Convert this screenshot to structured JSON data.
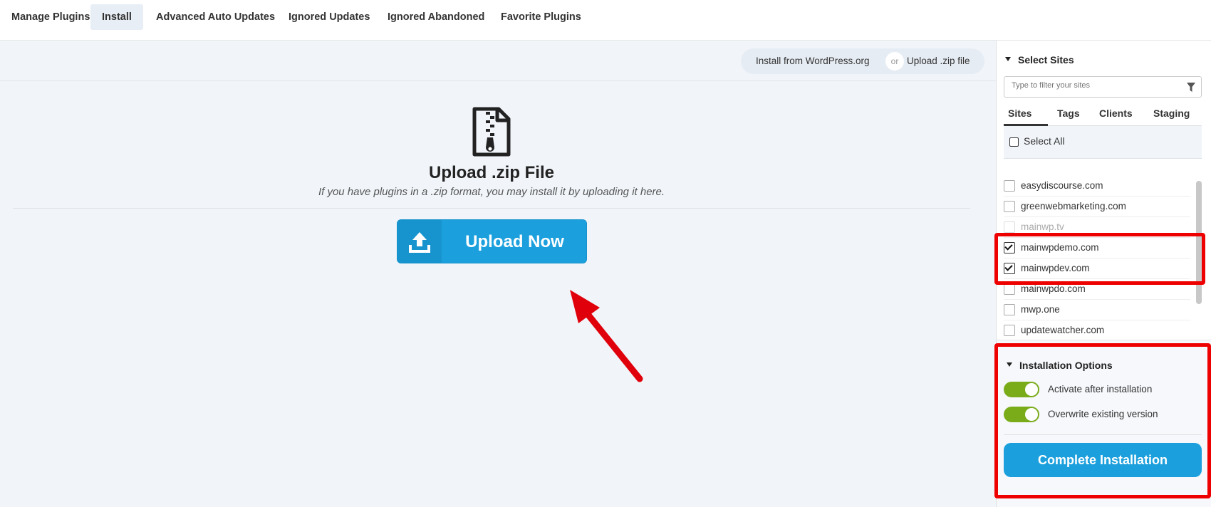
{
  "nav": {
    "tabs": [
      {
        "label": "Manage Plugins"
      },
      {
        "label": "Install"
      },
      {
        "label": "Advanced Auto Updates"
      },
      {
        "label": "Ignored Updates"
      },
      {
        "label": "Ignored Abandoned"
      },
      {
        "label": "Favorite Plugins"
      }
    ],
    "active_tab": "Install"
  },
  "source_toggle": {
    "option1": "Install from WordPress.org",
    "or": "or",
    "option2": "Upload .zip file"
  },
  "upload": {
    "title": "Upload .zip File",
    "subtitle": "If you have plugins in a .zip format, you may install it by uploading it here.",
    "button_label": "Upload Now"
  },
  "sidebar": {
    "select_sites_title": "Select Sites",
    "filter_placeholder": "Type to filter your sites",
    "tabs": [
      {
        "label": "Sites"
      },
      {
        "label": "Tags"
      },
      {
        "label": "Clients"
      },
      {
        "label": "Staging"
      }
    ],
    "select_all_label": "Select All",
    "sites": [
      {
        "name": "easydiscourse.com",
        "checked": false,
        "disabled": false
      },
      {
        "name": "greenwebmarketing.com",
        "checked": false,
        "disabled": false
      },
      {
        "name": "mainwp.tv",
        "checked": false,
        "disabled": true
      },
      {
        "name": "mainwpdemo.com",
        "checked": true,
        "disabled": false
      },
      {
        "name": "mainwpdev.com",
        "checked": true,
        "disabled": false
      },
      {
        "name": "mainwpdo.com",
        "checked": false,
        "disabled": false
      },
      {
        "name": "mwp.one",
        "checked": false,
        "disabled": false
      },
      {
        "name": "updatewatcher.com",
        "checked": false,
        "disabled": false
      }
    ],
    "installation_options_title": "Installation Options",
    "options": [
      {
        "label": "Activate after installation",
        "on": true
      },
      {
        "label": "Overwrite existing version",
        "on": true
      }
    ],
    "complete_button": "Complete Installation"
  },
  "colors": {
    "accent_blue": "#1ba0dd",
    "toggle_green": "#7aac1a",
    "highlight_red": "#ee0000",
    "main_bg": "#f1f5fa"
  }
}
